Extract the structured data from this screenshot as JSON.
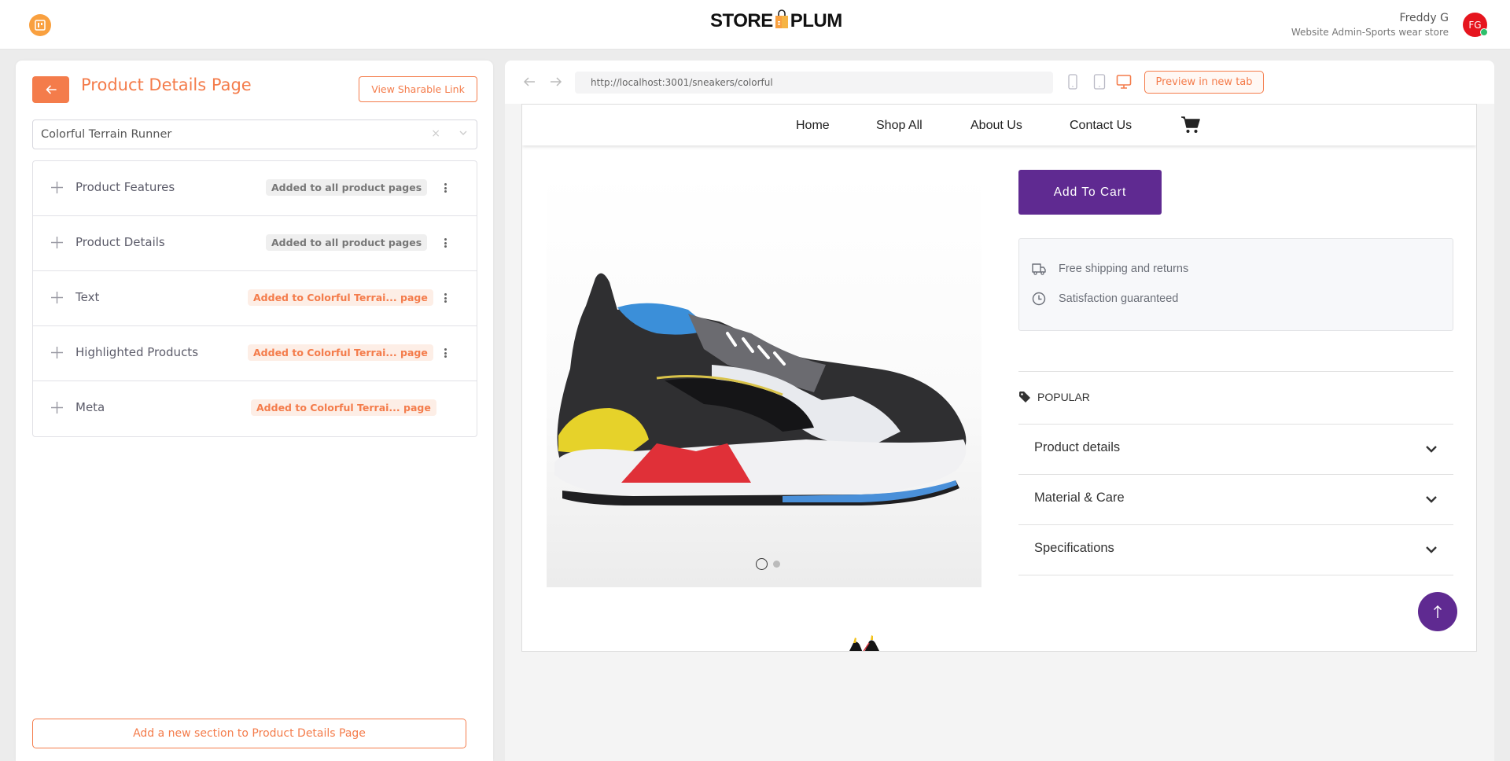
{
  "topbar": {
    "app_icon": "board-icon",
    "logo": {
      "left": "STORE",
      "right": "PLUM"
    },
    "user": {
      "name": "Freddy G",
      "role": "Website Admin-Sports wear store",
      "initials": "FG",
      "status_color": "#2dbf6b"
    }
  },
  "editor": {
    "title": "Product Details Page",
    "share_label": "View Sharable Link",
    "product_select": {
      "value": "Colorful Terrain Runner",
      "clear_label": "×"
    },
    "sections": [
      {
        "label": "Product Features",
        "badge": "Added to all product pages",
        "scope": "global",
        "has_menu": true
      },
      {
        "label": "Product Details",
        "badge": "Added to all product pages",
        "scope": "global",
        "has_menu": true
      },
      {
        "label": "Text",
        "badge": "Added to Colorful Terrai... page",
        "scope": "local",
        "has_menu": true
      },
      {
        "label": "Highlighted Products",
        "badge": "Added to Colorful Terrai... page",
        "scope": "local",
        "has_menu": true
      },
      {
        "label": "Meta",
        "badge": "Added to Colorful Terrai... page",
        "scope": "local",
        "has_menu": false
      }
    ],
    "add_section_label": "Add a new section to Product Details Page"
  },
  "preview": {
    "url": "http://localhost:3001/sneakers/colorful",
    "devices": [
      "mobile",
      "tablet",
      "desktop"
    ],
    "active_device": "desktop",
    "preview_label": "Preview in new tab",
    "site": {
      "nav": [
        "Home",
        "Shop All",
        "About Us",
        "Contact Us"
      ],
      "add_to_cart": "Add To Cart",
      "perks": [
        "Free shipping and returns",
        "Satisfaction guaranteed"
      ],
      "tag": "POPULAR",
      "accordion": [
        "Product details",
        "Material & Care",
        "Specifications"
      ],
      "carousel": {
        "count": 2,
        "active": 1
      }
    }
  },
  "colors": {
    "accent": "#f47c4b",
    "brand_purple": "#5f2a91",
    "avatar_red": "#e6151e"
  }
}
